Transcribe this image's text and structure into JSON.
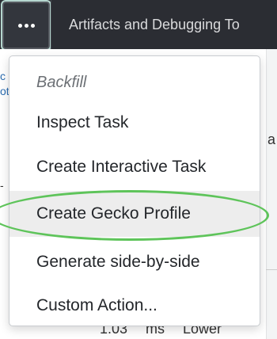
{
  "topbar": {
    "more_button": "more-actions",
    "title": "Artifacts and Debugging To"
  },
  "background": {
    "left_fragment_1": "c",
    "left_fragment_2": "ot",
    "left_dash": "-",
    "right_fragment": "a",
    "bottom_fragment": "1.03 ms Lower"
  },
  "menu": {
    "header": "Backfill",
    "items": [
      {
        "label": "Inspect Task"
      },
      {
        "label": "Create Interactive Task"
      },
      {
        "label": "Create Gecko Profile"
      },
      {
        "label": "Generate side-by-side"
      },
      {
        "label": "Custom Action..."
      }
    ]
  },
  "annotation": {
    "highlight_color": "#5ec45a"
  }
}
